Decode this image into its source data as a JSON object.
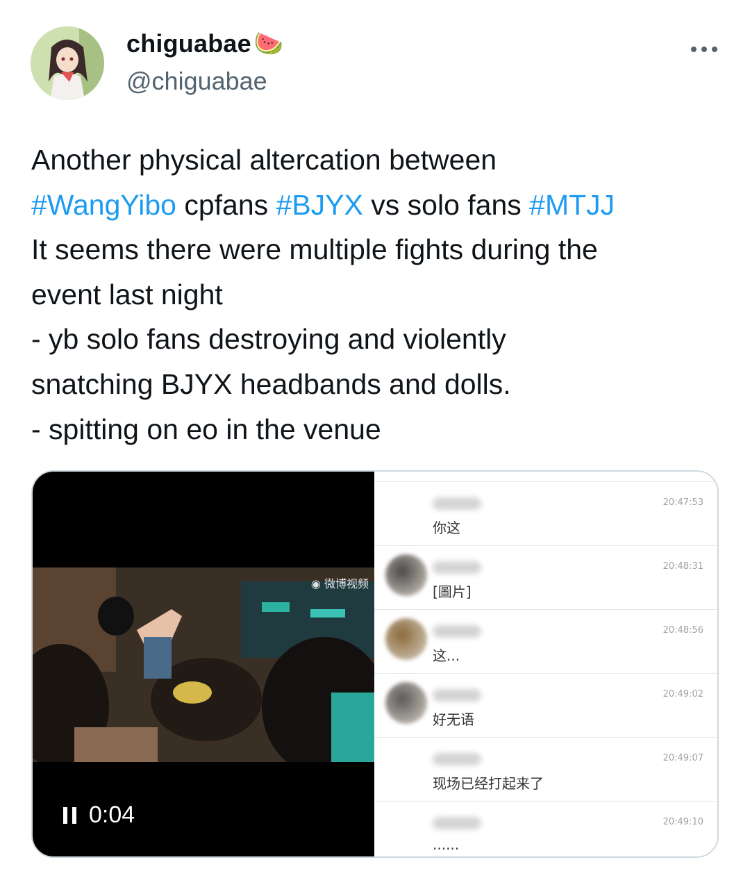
{
  "author": {
    "display_name": "chiguabae",
    "display_name_emoji": "🍉",
    "handle": "@chiguabae"
  },
  "more_icon": "more-horizontal-icon",
  "tweet": {
    "lines": [
      [
        {
          "t": "Another physical altercation between",
          "h": false
        }
      ],
      [
        {
          "t": "#WangYibo",
          "h": true
        },
        {
          "t": " cpfans ",
          "h": false
        },
        {
          "t": "#BJYX",
          "h": true
        },
        {
          "t": " vs solo fans ",
          "h": false
        },
        {
          "t": "#MTJJ",
          "h": true
        }
      ],
      [
        {
          "t": "It seems there were multiple fights during the",
          "h": false
        }
      ],
      [
        {
          "t": "event last night",
          "h": false
        }
      ],
      [
        {
          "t": "- yb solo fans destroying and violently",
          "h": false
        }
      ],
      [
        {
          "t": "snatching BJYX headbands and dolls.",
          "h": false
        }
      ],
      [
        {
          "t": "- spitting on eo in the venue",
          "h": false
        }
      ]
    ]
  },
  "video": {
    "time": "0:04",
    "control_icon": "pause-icon",
    "watermark": "微博视频"
  },
  "chat": [
    {
      "time": "20:47:53",
      "msg": "你这",
      "has_avatar": false
    },
    {
      "time": "20:48:31",
      "msg": "[圖片]",
      "has_avatar": true
    },
    {
      "time": "20:48:56",
      "msg": "这...",
      "has_avatar": true
    },
    {
      "time": "20:49:02",
      "msg": "好无语",
      "has_avatar": true
    },
    {
      "time": "20:49:07",
      "msg": "现场已经打起来了",
      "has_avatar": false
    },
    {
      "time": "20:49:10",
      "msg": "......",
      "has_avatar": false
    }
  ],
  "colors": {
    "hashtag": "#1d9bf0",
    "secondary_text": "#536471",
    "border": "#cfd9de"
  }
}
